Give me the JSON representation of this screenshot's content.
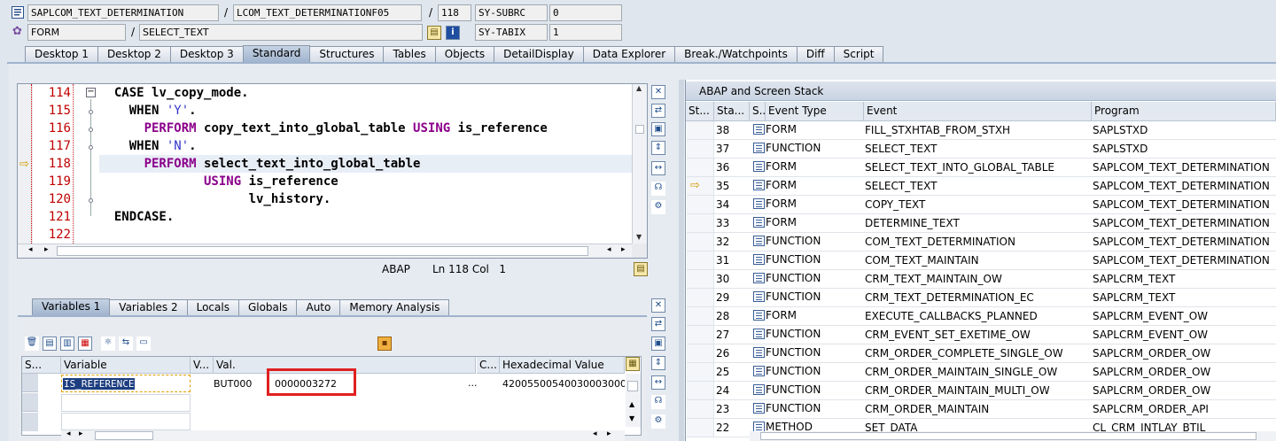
{
  "header": {
    "program_icon": "program-icon",
    "program_field": "SAPLCOM_TEXT_DETERMINATION",
    "include_field": "LCOM_TEXT_DETERMINATIONF05",
    "line_field": "118",
    "sy_subrc_label": "SY-SUBRC",
    "sy_subrc_value": "0",
    "event_type_field": "FORM",
    "event_field": "SELECT_TEXT",
    "sy_tabix_label": "SY-TABIX",
    "sy_tabix_value": "1",
    "slash": "/"
  },
  "main_tabs": [
    {
      "label": "Desktop 1"
    },
    {
      "label": "Desktop 2"
    },
    {
      "label": "Desktop 3"
    },
    {
      "label": "Standard",
      "active": true
    },
    {
      "label": "Structures"
    },
    {
      "label": "Tables"
    },
    {
      "label": "Objects"
    },
    {
      "label": "DetailDisplay"
    },
    {
      "label": "Data Explorer"
    },
    {
      "label": "Break./Watchpoints"
    },
    {
      "label": "Diff"
    },
    {
      "label": "Script"
    }
  ],
  "editor": {
    "lines": [
      {
        "num": "114",
        "parts": [
          {
            "t": "  CASE ",
            "c": "kw"
          },
          {
            "t": "lv_copy_mode",
            "c": "kw"
          },
          {
            "t": ".",
            "c": "kw"
          }
        ]
      },
      {
        "num": "115",
        "parts": [
          {
            "t": "    WHEN ",
            "c": "kw"
          },
          {
            "t": "'Y'",
            "c": "str"
          },
          {
            "t": ".",
            "c": "kw"
          }
        ]
      },
      {
        "num": "116",
        "parts": [
          {
            "t": "      PERFORM ",
            "c": "kw2"
          },
          {
            "t": "copy_text_into_global_table ",
            "c": "kw"
          },
          {
            "t": "USING ",
            "c": "kw2"
          },
          {
            "t": "is_reference",
            "c": "kw"
          }
        ]
      },
      {
        "num": "117",
        "parts": [
          {
            "t": "    WHEN ",
            "c": "kw"
          },
          {
            "t": "'N'",
            "c": "str"
          },
          {
            "t": ".",
            "c": "kw"
          }
        ]
      },
      {
        "num": "118",
        "parts": [
          {
            "t": "      PERFORM ",
            "c": "kw2"
          },
          {
            "t": "select_text_into_global_table",
            "c": "kw"
          }
        ]
      },
      {
        "num": "119",
        "parts": [
          {
            "t": "              USING ",
            "c": "kw2"
          },
          {
            "t": "is_reference",
            "c": "kw"
          }
        ]
      },
      {
        "num": "120",
        "parts": [
          {
            "t": "                    lv_history",
            "c": "kw"
          },
          {
            "t": ".",
            "c": "kw"
          }
        ]
      },
      {
        "num": "121",
        "parts": [
          {
            "t": "  ENDCASE",
            "c": "kw"
          },
          {
            "t": ".",
            "c": "kw"
          }
        ]
      },
      {
        "num": "122",
        "parts": [
          {
            "t": "",
            "c": "kw"
          }
        ]
      }
    ],
    "status_lang": "ABAP",
    "status_pos": "Ln 118 Col   1"
  },
  "var_tabs": [
    {
      "label": "Variables 1",
      "active": true
    },
    {
      "label": "Variables 2"
    },
    {
      "label": "Locals"
    },
    {
      "label": "Globals"
    },
    {
      "label": "Auto"
    },
    {
      "label": "Memory Analysis"
    }
  ],
  "var_table": {
    "headers": [
      "S...",
      "Variable",
      "V...",
      "Val.",
      "C...",
      "Hexadecimal Value"
    ],
    "row": {
      "variable": "IS_REFERENCE",
      "val_type": "BUT000",
      "value": "0000003272",
      "c": "...",
      "hex": "42005500540030003000"
    }
  },
  "stack": {
    "title": "ABAP and Screen Stack",
    "headers": [
      "St...",
      "Sta...",
      "S...",
      "Event Type",
      "Event",
      "Program"
    ],
    "rows": [
      {
        "no": "38",
        "type": "FORM",
        "event": "FILL_STXHTAB_FROM_STXH",
        "program": "SAPLSTXD"
      },
      {
        "no": "37",
        "type": "FUNCTION",
        "event": "SELECT_TEXT",
        "program": "SAPLSTXD"
      },
      {
        "no": "36",
        "type": "FORM",
        "event": "SELECT_TEXT_INTO_GLOBAL_TABLE",
        "program": "SAPLCOM_TEXT_DETERMINATION"
      },
      {
        "no": "35",
        "type": "FORM",
        "event": "SELECT_TEXT",
        "program": "SAPLCOM_TEXT_DETERMINATION",
        "current": true
      },
      {
        "no": "34",
        "type": "FORM",
        "event": "COPY_TEXT",
        "program": "SAPLCOM_TEXT_DETERMINATION"
      },
      {
        "no": "33",
        "type": "FORM",
        "event": "DETERMINE_TEXT",
        "program": "SAPLCOM_TEXT_DETERMINATION"
      },
      {
        "no": "32",
        "type": "FUNCTION",
        "event": "COM_TEXT_DETERMINATION",
        "program": "SAPLCOM_TEXT_DETERMINATION"
      },
      {
        "no": "31",
        "type": "FUNCTION",
        "event": "COM_TEXT_MAINTAIN",
        "program": "SAPLCOM_TEXT_DETERMINATION"
      },
      {
        "no": "30",
        "type": "FUNCTION",
        "event": "CRM_TEXT_MAINTAIN_OW",
        "program": "SAPLCRM_TEXT"
      },
      {
        "no": "29",
        "type": "FUNCTION",
        "event": "CRM_TEXT_DETERMINATION_EC",
        "program": "SAPLCRM_TEXT"
      },
      {
        "no": "28",
        "type": "FORM",
        "event": "EXECUTE_CALLBACKS_PLANNED",
        "program": "SAPLCRM_EVENT_OW"
      },
      {
        "no": "27",
        "type": "FUNCTION",
        "event": "CRM_EVENT_SET_EXETIME_OW",
        "program": "SAPLCRM_EVENT_OW"
      },
      {
        "no": "26",
        "type": "FUNCTION",
        "event": "CRM_ORDER_COMPLETE_SINGLE_OW",
        "program": "SAPLCRM_ORDER_OW"
      },
      {
        "no": "25",
        "type": "FUNCTION",
        "event": "CRM_ORDER_MAINTAIN_SINGLE_OW",
        "program": "SAPLCRM_ORDER_OW"
      },
      {
        "no": "24",
        "type": "FUNCTION",
        "event": "CRM_ORDER_MAINTAIN_MULTI_OW",
        "program": "SAPLCRM_ORDER_OW"
      },
      {
        "no": "23",
        "type": "FUNCTION",
        "event": "CRM_ORDER_MAINTAIN",
        "program": "SAPLCRM_ORDER_API"
      },
      {
        "no": "22",
        "type": "METHOD",
        "event": "SET_DATA",
        "program": "CL_CRM_INTLAY_BTIL"
      }
    ]
  },
  "colors": {
    "highlight_box": "#e02020",
    "current_line": "#e8eef6",
    "accent": "#8a98aa"
  }
}
